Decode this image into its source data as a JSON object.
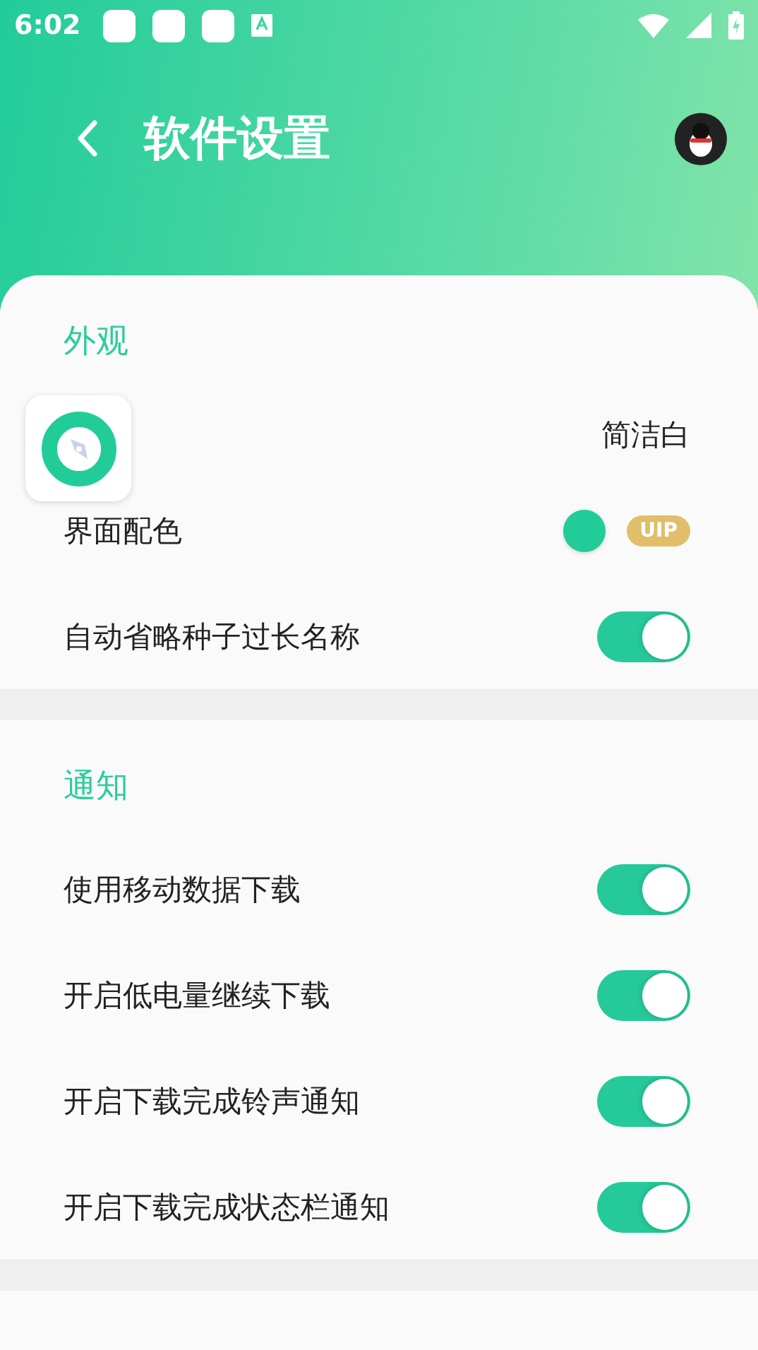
{
  "status_bar": {
    "time": "6:02"
  },
  "header": {
    "title": "软件设置"
  },
  "sections": [
    {
      "title": "外观",
      "items": [
        {
          "kind": "value",
          "value": "简洁白"
        },
        {
          "kind": "color",
          "label": "界面配色",
          "color": "#22cc99",
          "badge": "UIP"
        },
        {
          "kind": "toggle",
          "label": "自动省略种子过长名称",
          "on": true
        }
      ]
    },
    {
      "title": "通知",
      "items": [
        {
          "kind": "toggle",
          "label": "使用移动数据下载",
          "on": true
        },
        {
          "kind": "toggle",
          "label": "开启低电量继续下载",
          "on": true
        },
        {
          "kind": "toggle",
          "label": "开启下载完成铃声通知",
          "on": true
        },
        {
          "kind": "toggle",
          "label": "开启下载完成状态栏通知",
          "on": true
        }
      ]
    }
  ]
}
